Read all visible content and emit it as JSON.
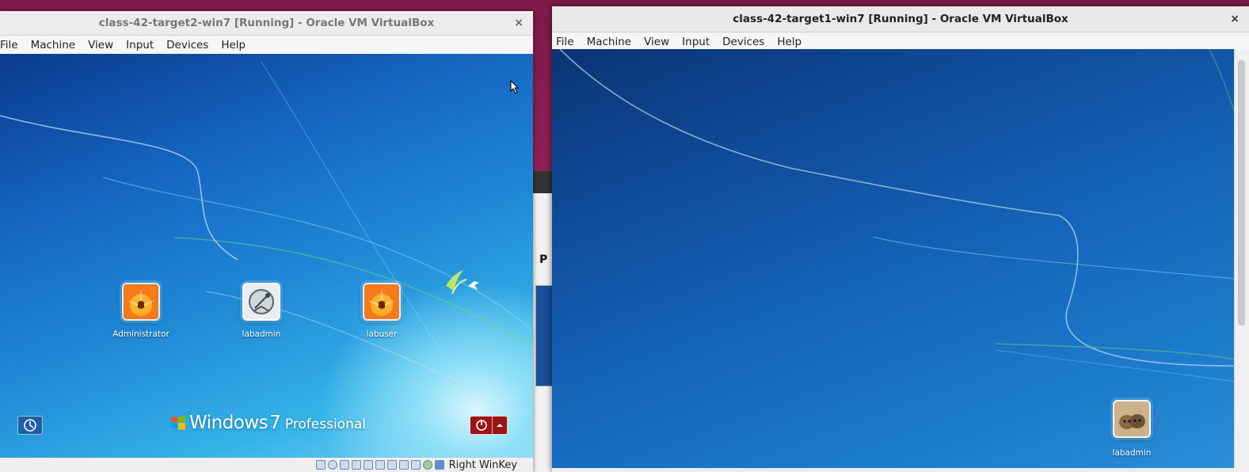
{
  "left_window": {
    "title": "class-42-target2-win7 [Running] - Oracle VM VirtualBox",
    "close": "×",
    "menu": [
      "File",
      "Machine",
      "View",
      "Input",
      "Devices",
      "Help"
    ],
    "login_screen": {
      "users": [
        {
          "name": "Administrator",
          "avatar": "flower-icon"
        },
        {
          "name": "labadmin",
          "avatar": "satellite-dish-icon"
        },
        {
          "name": "labuser",
          "avatar": "flower-icon"
        }
      ],
      "os_brand": {
        "windows": "Windows",
        "version": "7",
        "edition": "Professional"
      },
      "ease_of_access_icon": "ease-of-access-icon",
      "power_icon": "power-icon"
    },
    "status": {
      "host_key": "Right WinKey"
    }
  },
  "right_window": {
    "title": "class-42-target1-win7 [Running] - Oracle VM VirtualBox",
    "close": "×",
    "menu": [
      "File",
      "Machine",
      "View",
      "Input",
      "Devices",
      "Help"
    ],
    "desktop": {
      "user_tile": {
        "name": "labadmin",
        "avatar": "kitten-icon"
      }
    }
  },
  "background_window": {
    "partial_label": "P"
  },
  "colors": {
    "power_button": "#9c1414",
    "desktop_blue": "#1566ba"
  }
}
